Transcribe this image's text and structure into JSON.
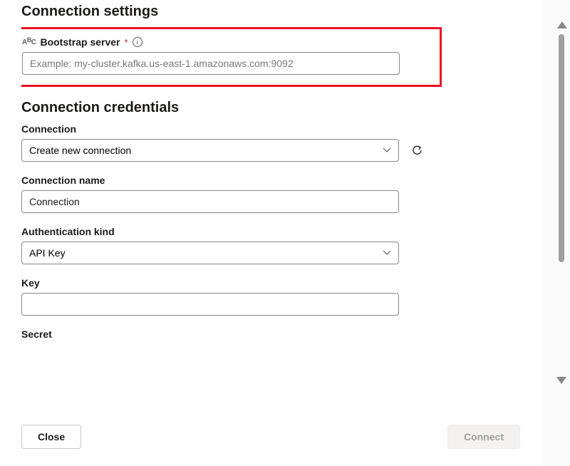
{
  "settings": {
    "heading": "Connection settings",
    "bootstrap": {
      "label": "Bootstrap server",
      "required_marker": "*",
      "placeholder": "Example: my-cluster.kafka.us-east-1.amazonaws.com:9092",
      "value": ""
    }
  },
  "credentials": {
    "heading": "Connection credentials",
    "connection": {
      "label": "Connection",
      "selected": "Create new connection"
    },
    "connection_name": {
      "label": "Connection name",
      "value": "Connection"
    },
    "auth_kind": {
      "label": "Authentication kind",
      "selected": "API Key"
    },
    "key": {
      "label": "Key",
      "value": ""
    },
    "secret": {
      "label": "Secret",
      "value": ""
    }
  },
  "footer": {
    "close": "Close",
    "connect": "Connect"
  }
}
